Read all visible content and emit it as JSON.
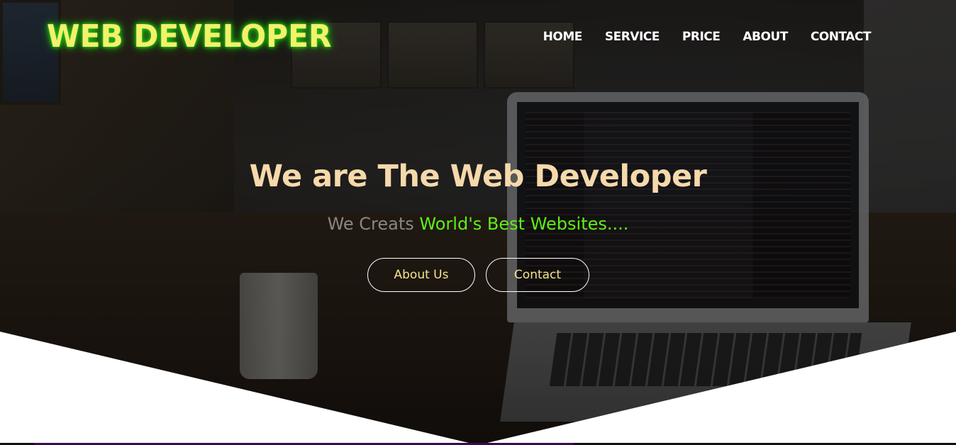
{
  "brand": {
    "logo_text": "WEB DEVELOPER"
  },
  "nav": {
    "items": [
      {
        "label": "HOME"
      },
      {
        "label": "SERVICE"
      },
      {
        "label": "PRICE"
      },
      {
        "label": "ABOUT"
      },
      {
        "label": "CONTACT"
      }
    ]
  },
  "hero": {
    "headline": "We are The Web Developer",
    "sub_muted": "We Creats",
    "sub_accent": "World's Best Websites....",
    "buttons": {
      "about_label": "About Us",
      "contact_label": "Contact"
    }
  },
  "colors": {
    "logo_text": "#f4f06c",
    "logo_glow": "#22c712",
    "headline": "#f6d9ab",
    "accent": "#5fef17",
    "button_text": "#f6e38f"
  }
}
